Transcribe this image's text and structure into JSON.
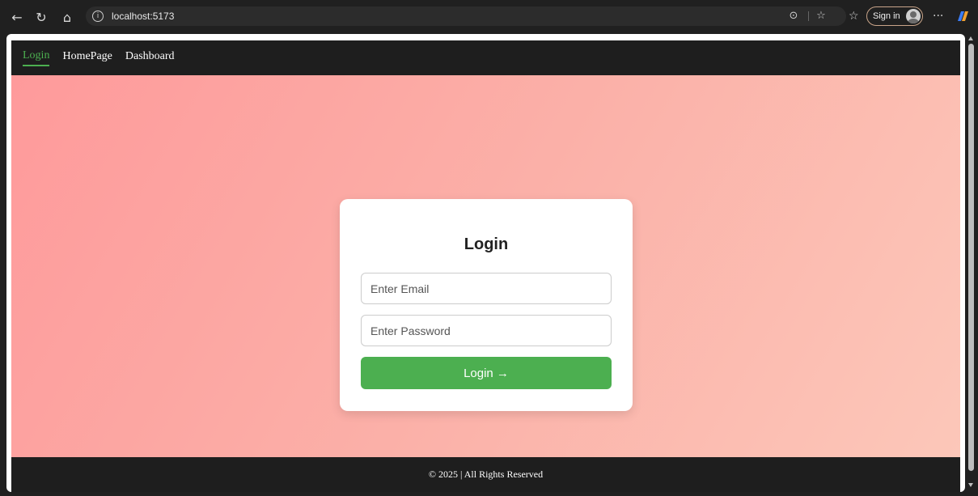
{
  "browser": {
    "url": "localhost:5173",
    "signin_label": "Sign in"
  },
  "nav": {
    "items": [
      {
        "label": "Login",
        "active": true
      },
      {
        "label": "HomePage",
        "active": false
      },
      {
        "label": "Dashboard",
        "active": false
      }
    ]
  },
  "login_card": {
    "title": "Login",
    "email_placeholder": "Enter Email",
    "password_placeholder": "Enter Password",
    "button_label": "Login →"
  },
  "footer": {
    "text": "© 2025 | All Rights Reserved"
  },
  "colors": {
    "accent": "#4caf50",
    "nav_bg": "#1e1e1e",
    "gradient_start": "#fe9a9b",
    "gradient_end": "#fcc7b9"
  }
}
